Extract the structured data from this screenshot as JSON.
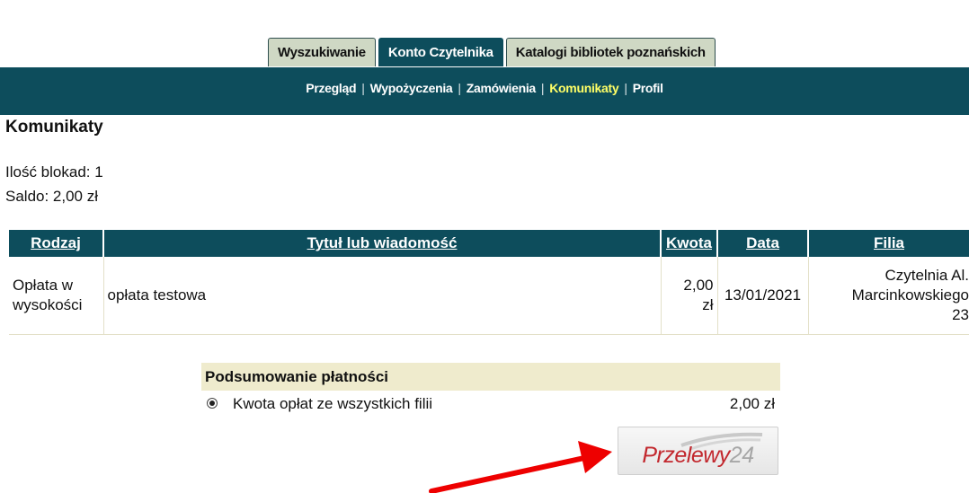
{
  "tabs": [
    {
      "label": "Wyszukiwanie",
      "active": false
    },
    {
      "label": "Konto Czytelnika",
      "active": true
    },
    {
      "label": "Katalogi bibliotek poznańskich",
      "active": false
    }
  ],
  "subnav": [
    {
      "label": "Przegląd",
      "current": false
    },
    {
      "label": "Wypożyczenia",
      "current": false
    },
    {
      "label": "Zamówienia",
      "current": false
    },
    {
      "label": "Komunikaty",
      "current": true
    },
    {
      "label": "Profil",
      "current": false
    }
  ],
  "page": {
    "title": "Komunikaty",
    "blocks": "Ilość blokad: 1",
    "saldo": "Saldo: 2,00 zł"
  },
  "table": {
    "headers": [
      "Rodzaj",
      "Tytuł lub wiadomość",
      "Kwota",
      "Data",
      "Filia"
    ],
    "rows": [
      {
        "type_line1": "Opłata w",
        "type_line2": "wysokości",
        "message": "opłata testowa",
        "amount_line1": "2,00",
        "amount_line2": "zł",
        "date": "13/01/2021",
        "branch_line1": "Czytelnia Al.",
        "branch_line2": "Marcinkowskiego",
        "branch_line3": "23"
      }
    ]
  },
  "payment": {
    "header": "Podsumowanie płatności",
    "option_label": "Kwota opłat ze wszystkich filii",
    "option_amount": "2,00 zł",
    "selected": true
  },
  "p24_logo": {
    "part1": "Przelewy",
    "part2": "24"
  },
  "colors": {
    "primary": "#0d4d5c",
    "tab_inactive": "#cfd8c4",
    "current_link": "#ffff66",
    "summary_header": "#efebcd",
    "arrow": "#ee0000",
    "p24_red": "#c2272d"
  }
}
